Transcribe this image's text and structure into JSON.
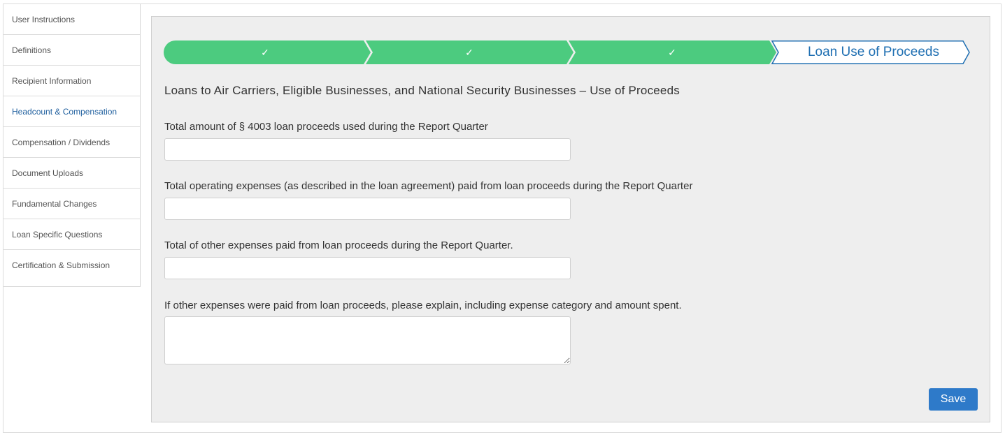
{
  "sidebar": {
    "items": [
      {
        "label": "User Instructions"
      },
      {
        "label": "Definitions"
      },
      {
        "label": "Recipient Information"
      },
      {
        "label": "Headcount & Compensation"
      },
      {
        "label": "Compensation / Dividends"
      },
      {
        "label": "Document Uploads"
      },
      {
        "label": "Fundamental Changes"
      },
      {
        "label": "Loan Specific Questions"
      },
      {
        "label": "Certification & Submission"
      }
    ],
    "active_item": "Headcount & Compensation"
  },
  "stepper": {
    "steps": [
      {
        "status": "complete",
        "icon": "check-icon",
        "symbol": "✓"
      },
      {
        "status": "complete",
        "icon": "check-icon",
        "symbol": "✓"
      },
      {
        "status": "complete",
        "icon": "check-icon",
        "symbol": "✓"
      },
      {
        "status": "current",
        "label": "Loan Use of Proceeds"
      }
    ],
    "complete_color": "#4ccb7f",
    "current_color": "#1f6fb2"
  },
  "form": {
    "title": "Loans to Air Carriers, Eligible Businesses, and National Security Businesses – Use of Proceeds",
    "fields": [
      {
        "label": "Total amount of § 4003 loan proceeds used during the Report Quarter",
        "value": "",
        "type": "input"
      },
      {
        "label": "Total operating expenses (as described in the loan agreement) paid from loan proceeds during the Report Quarter",
        "value": "",
        "type": "input"
      },
      {
        "label": "Total of other expenses paid from loan proceeds during the Report Quarter.",
        "value": "",
        "type": "input"
      },
      {
        "label": "If other expenses were paid from loan proceeds, please explain, including expense category and amount spent.",
        "value": "",
        "type": "textarea"
      }
    ],
    "save_label": "Save",
    "accent_color": "#2e7ac9"
  }
}
